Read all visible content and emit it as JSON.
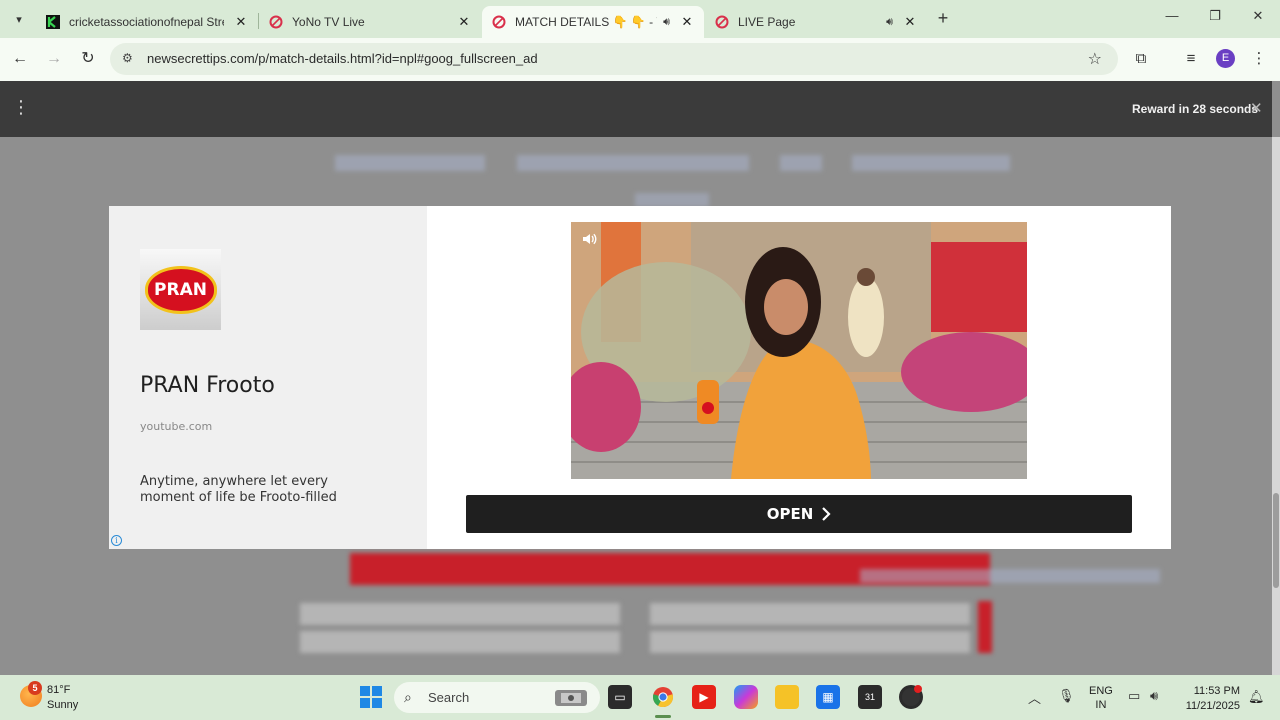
{
  "browser": {
    "tabs": [
      {
        "title": "cricketassociationofnepal Strea",
        "favicon": "k-logo-icon",
        "close": "✕"
      },
      {
        "title": "YoNo TV Live",
        "favicon": "opera-red-icon",
        "close": "✕"
      },
      {
        "title": "MATCH DETAILS 👇 👇 - Yo",
        "favicon": "opera-red-icon",
        "close": "✕",
        "active": true,
        "audio": true
      },
      {
        "title": "LIVE Page",
        "favicon": "opera-red-icon",
        "close": "✕",
        "audio": true
      }
    ],
    "url": "newsecrettips.com/p/match-details.html?id=npl#goog_fullscreen_ad",
    "profile_initial": "E"
  },
  "page": {
    "reward_text": "Reward in 28 seconds",
    "ad": {
      "brand_logo_text": "PRAN",
      "brand_name": "PRAN Frooto",
      "domain": "youtube.com",
      "description": "Anytime, anywhere let every moment of life be Frooto-filled",
      "cta_label": "OPEN"
    }
  },
  "taskbar": {
    "weather_badge": "5",
    "temperature": "81°F",
    "condition": "Sunny",
    "search_placeholder": "Search",
    "lang_line1": "ENG",
    "lang_line2": "IN",
    "time": "11:53 PM",
    "date": "11/21/2025"
  },
  "colors": {
    "accent_brand_red": "#d5101f",
    "cta_background": "#1f1f1f",
    "overlay_background": "#8f8f8f"
  }
}
